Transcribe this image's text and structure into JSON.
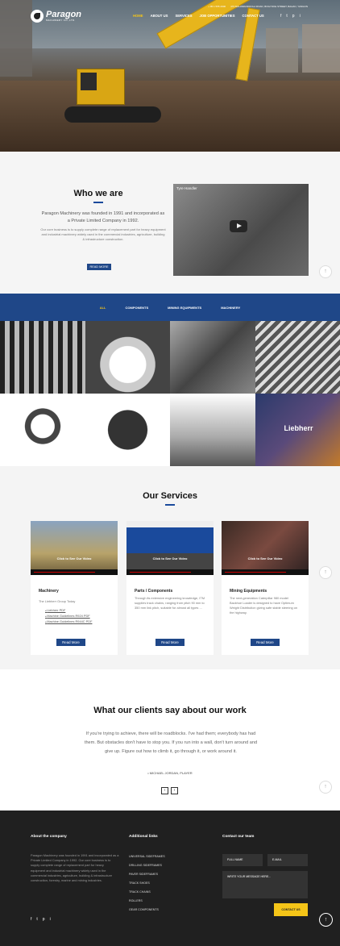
{
  "header": {
    "logo_name": "Paragon",
    "logo_sub": "MACHINERY CO.,LTD.",
    "phone": "+ 95 1 555 2000",
    "address": "473 MAHABANDOOLA ROAD, BOGYOKE STREET, BAHAN, YANGON",
    "nav": [
      "HOME",
      "ABOUT US",
      "SERVICES",
      "JOB OPPORTUNITIES",
      "CONTACT US"
    ],
    "social": [
      "f",
      "t",
      "p",
      "i"
    ],
    "colors": {
      "accent": "#f5c518",
      "brand": "#1f4788"
    }
  },
  "who": {
    "title": "Who we are",
    "p1": "Paragon Machinery was founded in 1991 and incorporated as a Private Limited Company in 1992.",
    "p2": "Our core business is to supply complete range of replacement part for heavy equipment and industrial machinery widely used in the commercial industries, agriculture, building & infrastructure construction.",
    "button": "READ MORE",
    "video_title": "Tyre Handler"
  },
  "filter": {
    "items": [
      "ALL",
      "COMPONENTS",
      "MINING EQUIPMENTS",
      "MACHINERY"
    ]
  },
  "gallery": {
    "tile8_label": "Liebherr"
  },
  "services": {
    "title": "Our Services",
    "video_caption": "Click to See Our Video",
    "cards": [
      {
        "title": "Machinery",
        "text": "The Liebherr Group Today",
        "links": [
          "Liebherr PDF",
          "Machine Guidelines R924 PDF",
          "Machine Guidelines R944C PDF"
        ],
        "button": "Read More"
      },
      {
        "title": "Parts / Components",
        "text": "Through its extensive engineering knowledge, ITM supplies track chains, ranging from pitch 90 mm to 350 mm link pitch, suitable for almost all types ...",
        "button": "Read More"
      },
      {
        "title": "Mining Equipments",
        "text": "The next-generation Caterpillar 980 model Backhoe Loader is designed to have Optimum Weight Distribution giving safe stable steering on the highway.",
        "button": "Read More"
      }
    ]
  },
  "clients": {
    "title": "What our clients say about our work",
    "quote": "If you're trying to achieve, there will be roadblocks. I've had them; everybody has had them. But obstacles don't have to stop you. If you run into a wall, don't turn around and give up. Figure out how to climb it, go through it, or work around it.",
    "author": "• MICHAEL JORDAN, PLAYER",
    "prev": "‹",
    "next": "›"
  },
  "footer": {
    "about_title": "About the company",
    "about_text": "Paragon Machinery was founded in 1991 and incorporated as a Private Limited Company in 1992. Our core business is to supply complete range of replacement part for heavy equipment and industrial machinery widely used in the commercial industries, agriculture, building & infrastructure construction, forestry, marine and mining industries.",
    "links_title": "Additional links",
    "links": [
      "UNIVERSAL SIDEFRAMES",
      "DRILLING SIDEFRAMES",
      "PAVER SIDEFRAMES",
      "TRACK SHOES",
      "TRACK CHAINS",
      "ROLLERS",
      "GEAR COMPONENTS"
    ],
    "contact_title": "Contact our team",
    "name_ph": "FULL NAME",
    "email_ph": "E-MAIL",
    "msg_ph": "WRITE YOUR MESSAGE HERE...",
    "send": "CONTACT US"
  }
}
